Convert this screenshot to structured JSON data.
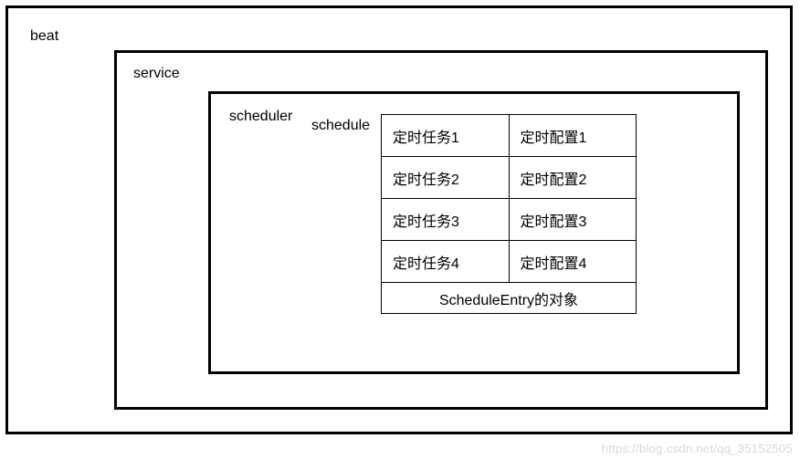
{
  "beat": {
    "label": "beat"
  },
  "service": {
    "label": "service"
  },
  "scheduler": {
    "label": "scheduler"
  },
  "schedule": {
    "label": "schedule",
    "rows": [
      {
        "task": "定时任务1",
        "config": "定时配置1"
      },
      {
        "task": "定时任务2",
        "config": "定时配置2"
      },
      {
        "task": "定时任务3",
        "config": "定时配置3"
      },
      {
        "task": "定时任务4",
        "config": "定时配置4"
      }
    ],
    "caption": "ScheduleEntry的对象"
  },
  "watermark": "https://blog.csdn.net/qq_35152505"
}
